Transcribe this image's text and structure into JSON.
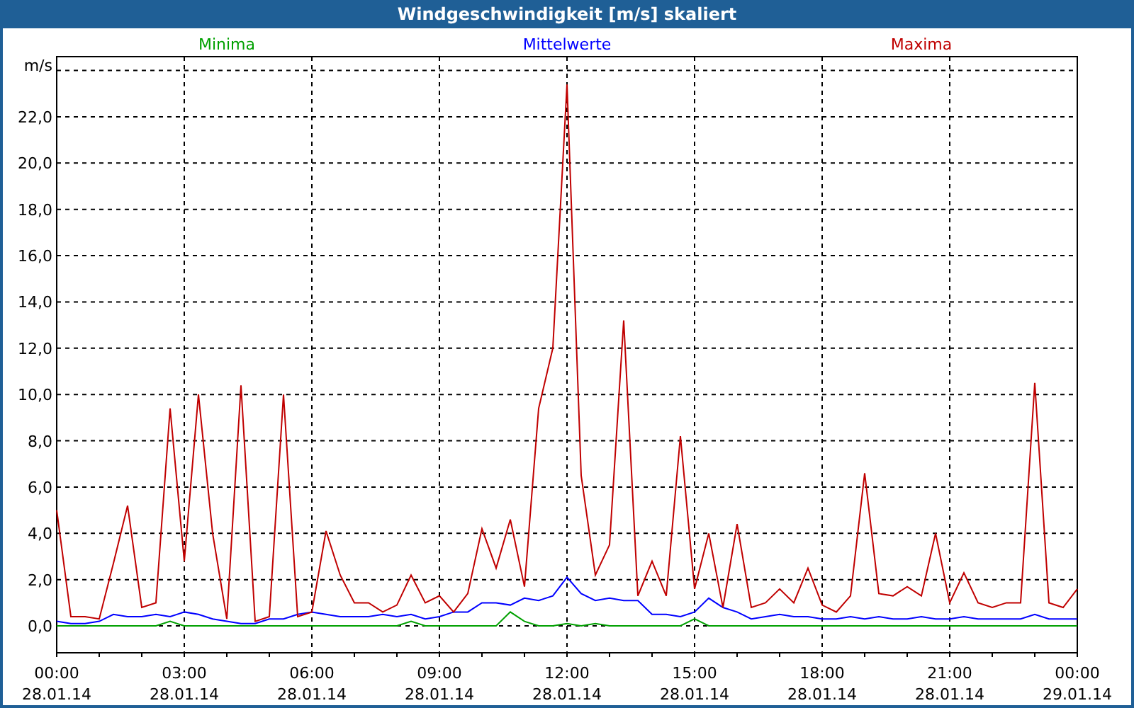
{
  "window": {
    "title": "Windgeschwindigkeit [m/s] skaliert"
  },
  "chart": {
    "chart_data": {
      "type": "line",
      "ylabel": "m/s",
      "ylim": [
        -1.16,
        24.6
      ],
      "grid": true,
      "yticks": [
        {
          "value": 0,
          "label": "0,0"
        },
        {
          "value": 2,
          "label": "2,0"
        },
        {
          "value": 4,
          "label": "4,0"
        },
        {
          "value": 6,
          "label": "6,0"
        },
        {
          "value": 8,
          "label": "8,0"
        },
        {
          "value": 10,
          "label": "10,0"
        },
        {
          "value": 12,
          "label": "12,0"
        },
        {
          "value": 14,
          "label": "14,0"
        },
        {
          "value": 16,
          "label": "16,0"
        },
        {
          "value": 18,
          "label": "18,0"
        },
        {
          "value": 20,
          "label": "20,0"
        },
        {
          "value": 22,
          "label": "22,0"
        }
      ],
      "categories": [
        "00:00\n28.01.14",
        null,
        null,
        null,
        null,
        null,
        null,
        null,
        null,
        "03:00\n28.01.14",
        null,
        null,
        null,
        null,
        null,
        null,
        null,
        null,
        "06:00\n28.01.14",
        null,
        null,
        null,
        null,
        null,
        null,
        null,
        null,
        "09:00\n28.01.14",
        null,
        null,
        null,
        null,
        null,
        null,
        null,
        null,
        "12:00\n28.01.14",
        null,
        null,
        null,
        null,
        null,
        null,
        null,
        null,
        "15:00\n28.01.14",
        null,
        null,
        null,
        null,
        null,
        null,
        null,
        null,
        "18:00\n28.01.14",
        null,
        null,
        null,
        null,
        null,
        null,
        null,
        null,
        "21:00\n28.01.14",
        null,
        null,
        null,
        null,
        null,
        null,
        null,
        null,
        "00:00\n29.01.14"
      ],
      "series": [
        {
          "name": "Minima",
          "color": "#00a000",
          "values": [
            0,
            0,
            0,
            0,
            0,
            0,
            0,
            0,
            0.2,
            0,
            0,
            0,
            0,
            0,
            0,
            0,
            0,
            0,
            0,
            0,
            0,
            0,
            0,
            0,
            0,
            0.2,
            0,
            0,
            0,
            0,
            0,
            0,
            0.6,
            0.2,
            0,
            0,
            0.1,
            0,
            0.1,
            0,
            0,
            0,
            0,
            0,
            0,
            0.3,
            0,
            0,
            0,
            0,
            0,
            0,
            0,
            0,
            0,
            0,
            0,
            0,
            0,
            0,
            0,
            0,
            0,
            0,
            0,
            0,
            0,
            0,
            0,
            0,
            0,
            0,
            0
          ]
        },
        {
          "name": "Mittelwerte",
          "color": "#0000ff",
          "values": [
            0.2,
            0.1,
            0.1,
            0.2,
            0.5,
            0.4,
            0.4,
            0.5,
            0.4,
            0.6,
            0.5,
            0.3,
            0.2,
            0.1,
            0.1,
            0.3,
            0.3,
            0.5,
            0.6,
            0.5,
            0.4,
            0.4,
            0.4,
            0.5,
            0.4,
            0.5,
            0.3,
            0.4,
            0.6,
            0.6,
            1.0,
            1.0,
            0.9,
            1.2,
            1.1,
            1.3,
            2.1,
            1.4,
            1.1,
            1.2,
            1.1,
            1.1,
            0.5,
            0.5,
            0.4,
            0.6,
            1.2,
            0.8,
            0.6,
            0.3,
            0.4,
            0.5,
            0.4,
            0.4,
            0.3,
            0.3,
            0.4,
            0.3,
            0.4,
            0.3,
            0.3,
            0.4,
            0.3,
            0.3,
            0.4,
            0.3,
            0.3,
            0.3,
            0.3,
            0.5,
            0.3,
            0.3,
            0.3
          ]
        },
        {
          "name": "Maxima",
          "color": "#c00000",
          "values": [
            5.0,
            0.4,
            0.4,
            0.3,
            2.7,
            5.2,
            0.8,
            1.0,
            9.4,
            2.8,
            10.0,
            4.0,
            0.3,
            10.4,
            0.2,
            0.4,
            10.0,
            0.4,
            0.6,
            4.1,
            2.2,
            1.0,
            1.0,
            0.6,
            0.9,
            2.2,
            1.0,
            1.3,
            0.6,
            1.4,
            4.2,
            2.5,
            4.6,
            1.7,
            9.4,
            12.0,
            23.4,
            6.5,
            2.2,
            3.5,
            13.2,
            1.3,
            2.8,
            1.3,
            8.2,
            1.6,
            4.0,
            0.8,
            4.4,
            0.8,
            1.0,
            1.6,
            1.0,
            2.5,
            0.9,
            0.6,
            1.3,
            6.6,
            1.4,
            1.3,
            1.7,
            1.3,
            4.0,
            1.0,
            2.3,
            1.0,
            0.8,
            1.0,
            1.0,
            10.5,
            1.0,
            0.8,
            1.6
          ]
        }
      ]
    }
  }
}
